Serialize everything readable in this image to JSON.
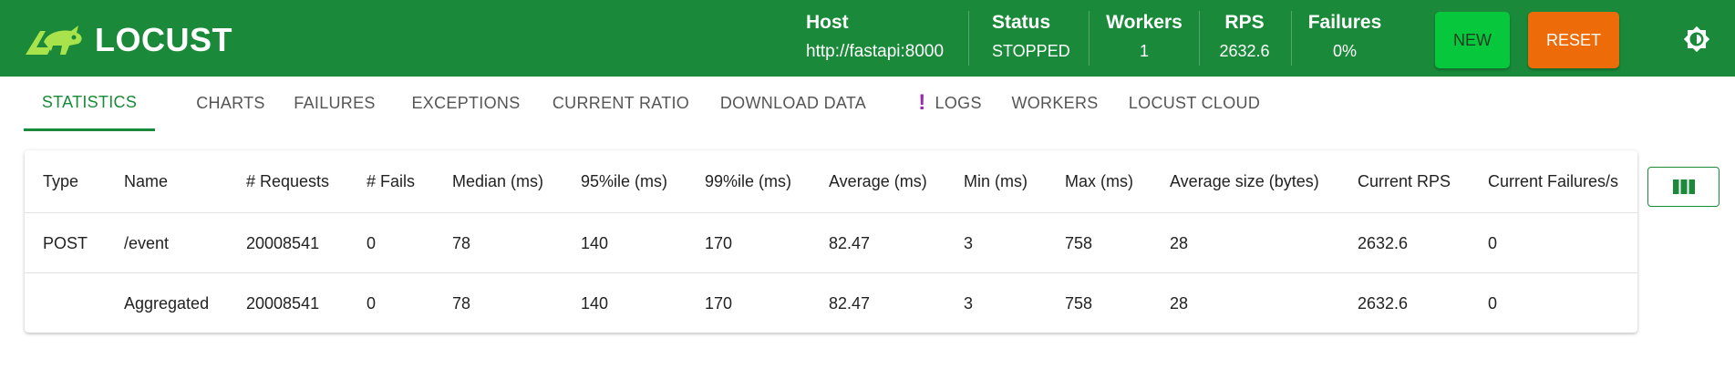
{
  "brand": {
    "name": "LOCUST"
  },
  "header": {
    "host": {
      "label": "Host",
      "value": "http://fastapi:8000"
    },
    "status": {
      "label": "Status",
      "value": "STOPPED"
    },
    "workers": {
      "label": "Workers",
      "value": "1"
    },
    "rps": {
      "label": "RPS",
      "value": "2632.6"
    },
    "failures": {
      "label": "Failures",
      "value": "0%"
    },
    "new_label": "NEW",
    "reset_label": "RESET",
    "theme_icon": "brightness-icon"
  },
  "tabs": [
    {
      "label": "STATISTICS",
      "active": true
    },
    {
      "label": "CHARTS"
    },
    {
      "label": "FAILURES"
    },
    {
      "label": "EXCEPTIONS"
    },
    {
      "label": "CURRENT RATIO"
    },
    {
      "label": "DOWNLOAD DATA"
    },
    {
      "label": "LOGS",
      "alert": "!"
    },
    {
      "label": "WORKERS"
    },
    {
      "label": "LOCUST CLOUD"
    }
  ],
  "table": {
    "columns": [
      "Type",
      "Name",
      "# Requests",
      "# Fails",
      "Median (ms)",
      "95%ile (ms)",
      "99%ile (ms)",
      "Average (ms)",
      "Min (ms)",
      "Max (ms)",
      "Average size (bytes)",
      "Current RPS",
      "Current Failures/s"
    ],
    "rows": [
      [
        "POST",
        "/event",
        "20008541",
        "0",
        "78",
        "140",
        "170",
        "82.47",
        "3",
        "758",
        "28",
        "2632.6",
        "0"
      ],
      [
        "",
        "Aggregated",
        "20008541",
        "0",
        "78",
        "140",
        "170",
        "82.47",
        "3",
        "758",
        "28",
        "2632.6",
        "0"
      ]
    ]
  },
  "column_selector_icon": "view-column-icon",
  "colors": {
    "brand_green": "#1a8a3a",
    "new_green": "#07c83c",
    "reset_orange": "#ee6b09",
    "logs_alert": "#9c27b0"
  }
}
